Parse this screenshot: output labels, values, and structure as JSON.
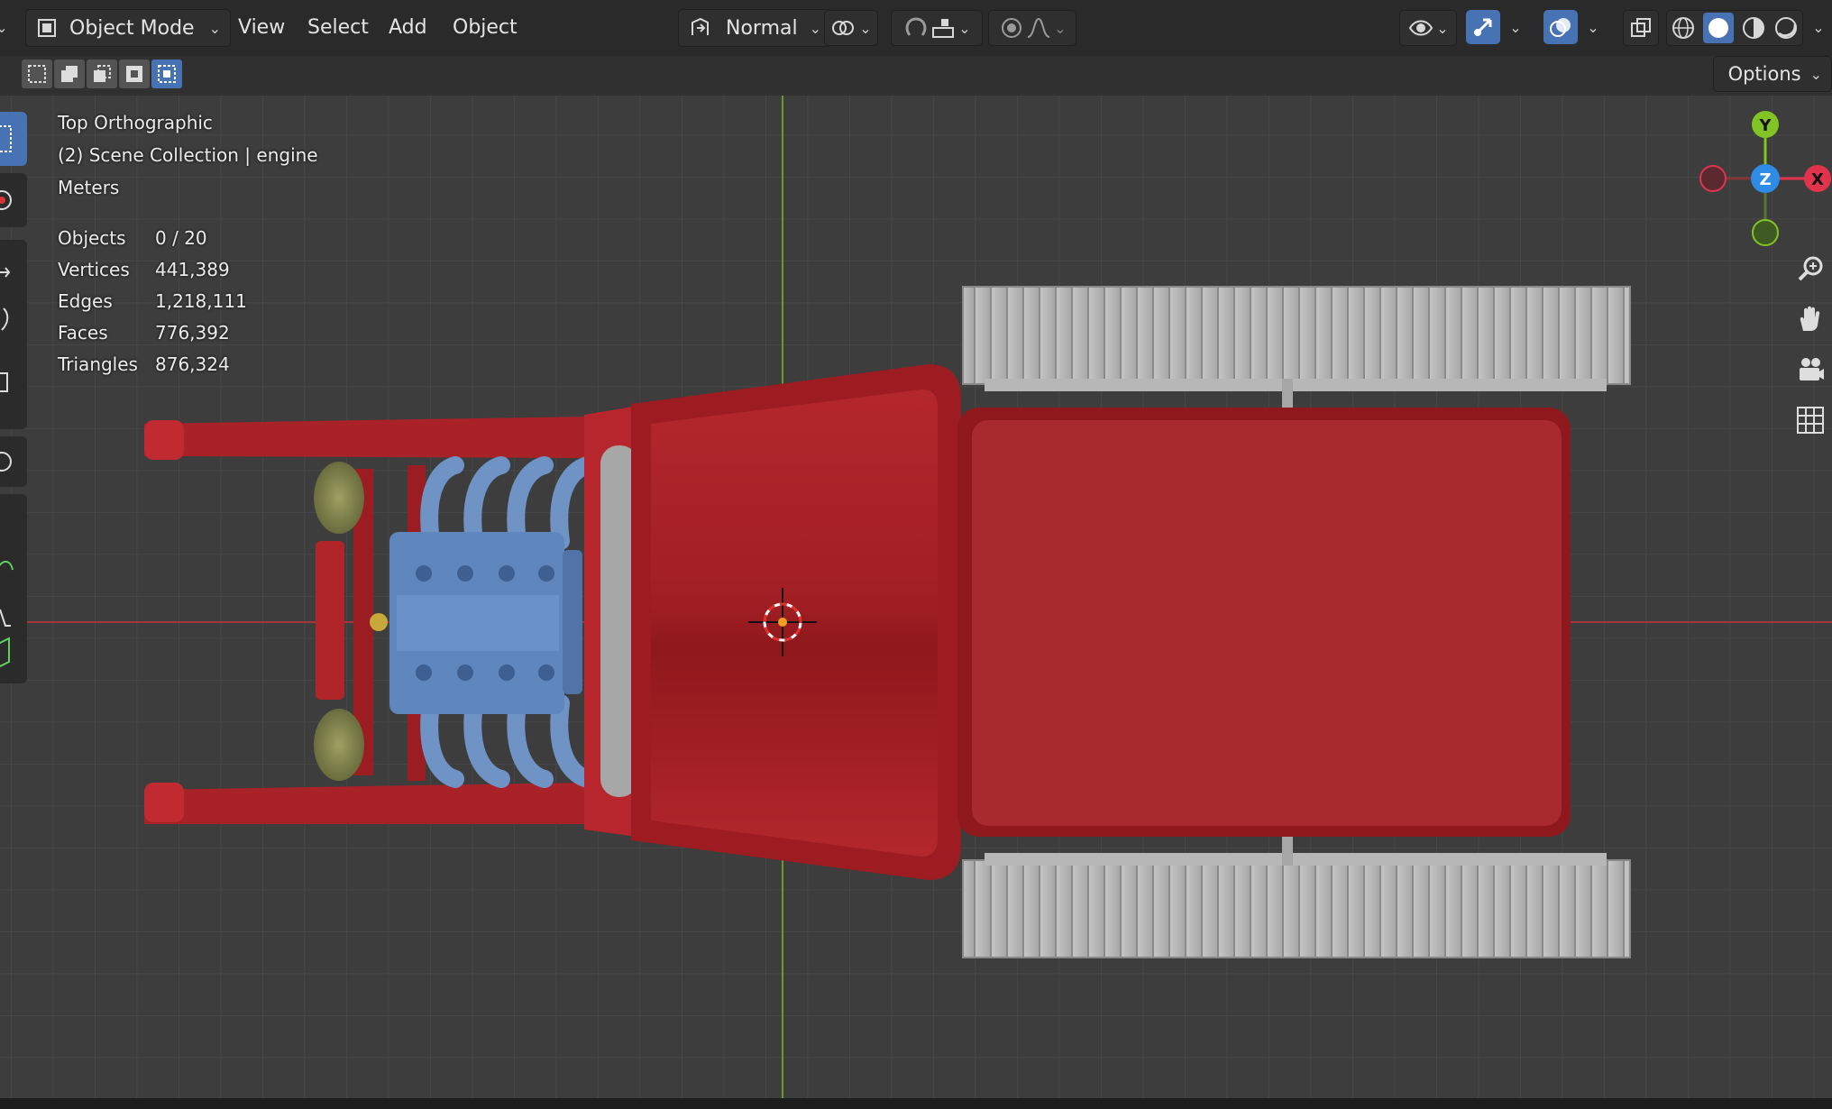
{
  "header": {
    "mode_label": "Object Mode",
    "menu": [
      "View",
      "Select",
      "Add",
      "Object"
    ],
    "transform_orientation": "Normal",
    "icons": [
      "mode-icon",
      "transform-orientation-icon",
      "pivot-icon",
      "snap-icon",
      "snap-increment-icon",
      "proportional-edit-icon",
      "falloff-icon",
      "visibility-icon",
      "gizmo-icon",
      "overlay-icon",
      "xray-icon",
      "wireframe-shading-icon",
      "solid-shading-icon",
      "material-shading-icon",
      "rendered-shading-icon"
    ]
  },
  "options_label": "Options",
  "viewport": {
    "view_name": "Top Orthographic",
    "collection": "(2) Scene Collection | engine",
    "units": "Meters",
    "stats": [
      {
        "label": "Objects",
        "value": "0 / 20"
      },
      {
        "label": "Vertices",
        "value": "441,389"
      },
      {
        "label": "Edges",
        "value": "1,218,111"
      },
      {
        "label": "Faces",
        "value": "776,392"
      },
      {
        "label": "Triangles",
        "value": "876,324"
      }
    ]
  },
  "gizmo": {
    "x": "X",
    "y": "Y",
    "z": "Z",
    "colors": {
      "x": "#e2334c",
      "y": "#82c424",
      "z": "#2e8be6"
    }
  },
  "colors": {
    "accent": "#4772b3",
    "body_red": "#b2272c",
    "engine_blue": "#5f86bd",
    "tire_gray": "#bdbdbd",
    "headlight": "#7a7f4a"
  }
}
